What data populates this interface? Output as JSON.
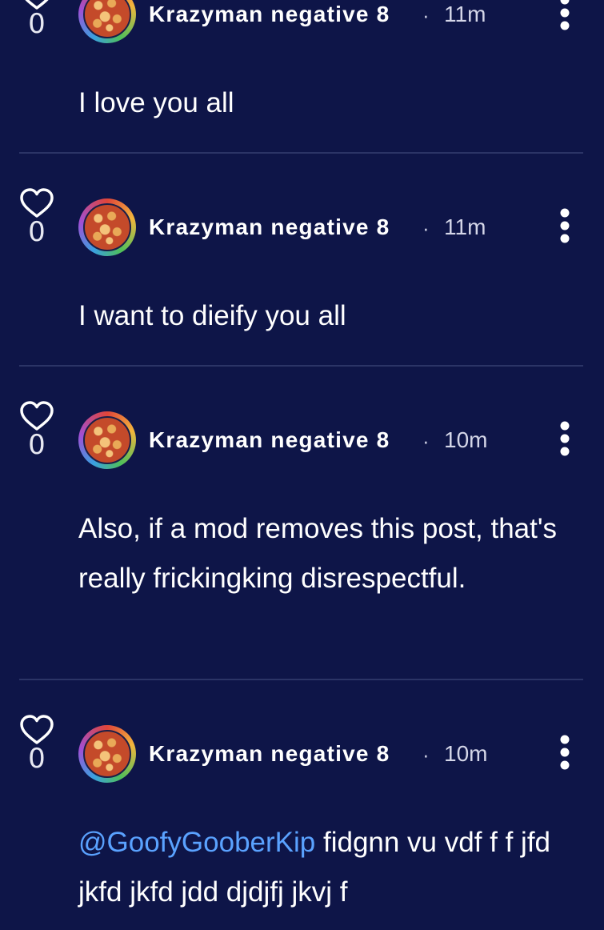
{
  "comments": [
    {
      "likes": "0",
      "author": "Krazyman negative 8",
      "separator": "·",
      "time": "11m",
      "text": "I love you all"
    },
    {
      "likes": "0",
      "author": "Krazyman negative 8",
      "separator": "·",
      "time": "11m",
      "text": "I want to dieify you all"
    },
    {
      "likes": "0",
      "author": "Krazyman negative 8",
      "separator": "·",
      "time": "10m",
      "text": "Also, if a mod removes this post, that's really frickingking disrespectful."
    },
    {
      "likes": "0",
      "author": "Krazyman negative 8",
      "separator": "·",
      "time": "10m",
      "mention": "@GoofyGooberKip",
      "text": " fidgnn  vu vdf f f jfd jkfd jkfd jdd djdjfj  jkvj f"
    }
  ],
  "colors": {
    "background": "#0e1548",
    "mention": "#5aa2ff",
    "divider": "#2b3466"
  }
}
